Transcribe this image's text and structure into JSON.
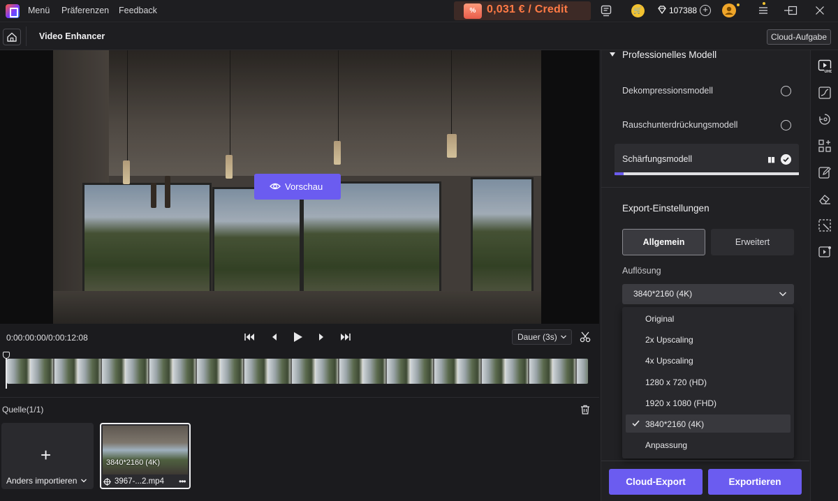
{
  "titlebar": {
    "menu": [
      "Menü",
      "Präferenzen",
      "Feedback"
    ],
    "promo_badge": "%",
    "promo_text": "0,031 € / Credit",
    "credits": "107388"
  },
  "header": {
    "page_title": "Video Enhancer",
    "cloud_task": "Cloud-Aufgabe"
  },
  "preview": {
    "button_label": "Vorschau"
  },
  "playback": {
    "timecode": "0:00:00:00/0:00:12:08",
    "duration": "Dauer (3s)"
  },
  "source": {
    "title": "Quelle(1/1)",
    "import_label": "Anders importieren",
    "file": {
      "resolution": "3840*2160 (4K)",
      "name": "3967-...2.mp4"
    }
  },
  "models": {
    "section_title": "Professionelles Modell",
    "items": [
      {
        "label": "Dekompressionsmodell",
        "state": "off"
      },
      {
        "label": "Rauschunterdrückungsmodell",
        "state": "off"
      },
      {
        "label": "Schärfungsmodell",
        "state": "processing",
        "progress": 0.05
      }
    ]
  },
  "export": {
    "section_title": "Export-Einstellungen",
    "tabs": [
      "Allgemein",
      "Erweitert"
    ],
    "active_tab": "Allgemein",
    "resolution_label": "Auflösung",
    "resolution_value": "3840*2160 (4K)",
    "options": [
      "Original",
      "2x Upscaling",
      "4x Upscaling",
      "1280 x 720 (HD)",
      "1920 x 1080 (FHD)",
      "3840*2160 (4K)",
      "Anpassung"
    ],
    "selected_option": "3840*2160 (4K)",
    "cloud_export": "Cloud-Export",
    "export": "Exportieren"
  },
  "colors": {
    "accent": "#6b5cf0",
    "promo": "#ff7a45"
  }
}
